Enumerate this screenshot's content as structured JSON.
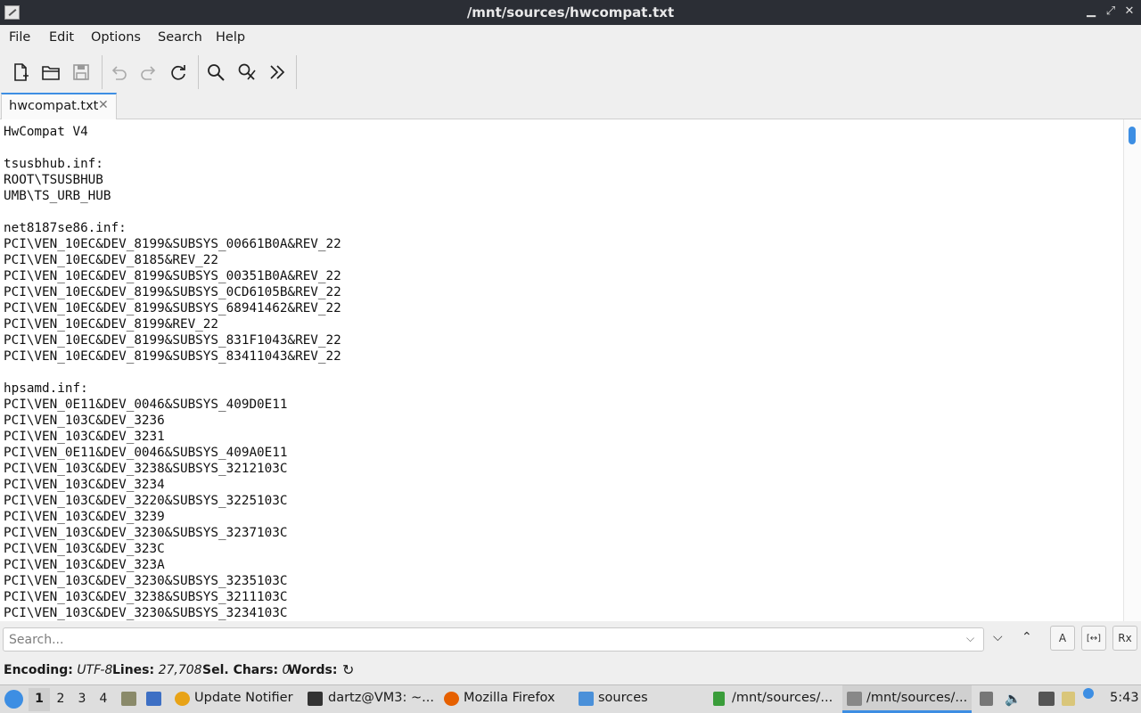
{
  "window": {
    "title": "/mnt/sources/hwcompat.txt",
    "minimize": "▁",
    "maximize": "⤢",
    "close": "✕"
  },
  "menu": {
    "file": "File",
    "edit": "Edit",
    "options": "Options",
    "search": "Search",
    "help": "Help"
  },
  "toolbar_icons": [
    "new-document-icon",
    "open-folder-icon",
    "save-icon",
    "undo-icon",
    "redo-icon",
    "reload-icon",
    "find-icon",
    "replace-icon",
    "more-icon"
  ],
  "tab": {
    "label": "hwcompat.txt",
    "close": "✕"
  },
  "editor": {
    "lines": [
      "HwCompat V4",
      "",
      "tsusbhub.inf:",
      "ROOT\\TSUSBHUB",
      "UMB\\TS_URB_HUB",
      "",
      "net8187se86.inf:",
      "PCI\\VEN_10EC&DEV_8199&SUBSYS_00661B0A&REV_22",
      "PCI\\VEN_10EC&DEV_8185&REV_22",
      "PCI\\VEN_10EC&DEV_8199&SUBSYS_00351B0A&REV_22",
      "PCI\\VEN_10EC&DEV_8199&SUBSYS_0CD6105B&REV_22",
      "PCI\\VEN_10EC&DEV_8199&SUBSYS_68941462&REV_22",
      "PCI\\VEN_10EC&DEV_8199&REV_22",
      "PCI\\VEN_10EC&DEV_8199&SUBSYS_831F1043&REV_22",
      "PCI\\VEN_10EC&DEV_8199&SUBSYS_83411043&REV_22",
      "",
      "hpsamd.inf:",
      "PCI\\VEN_0E11&DEV_0046&SUBSYS_409D0E11",
      "PCI\\VEN_103C&DEV_3236",
      "PCI\\VEN_103C&DEV_3231",
      "PCI\\VEN_0E11&DEV_0046&SUBSYS_409A0E11",
      "PCI\\VEN_103C&DEV_3238&SUBSYS_3212103C",
      "PCI\\VEN_103C&DEV_3234",
      "PCI\\VEN_103C&DEV_3220&SUBSYS_3225103C",
      "PCI\\VEN_103C&DEV_3239",
      "PCI\\VEN_103C&DEV_3230&SUBSYS_3237103C",
      "PCI\\VEN_103C&DEV_323C",
      "PCI\\VEN_103C&DEV_323A",
      "PCI\\VEN_103C&DEV_3230&SUBSYS_3235103C",
      "PCI\\VEN_103C&DEV_3238&SUBSYS_3211103C",
      "PCI\\VEN_103C&DEV_3230&SUBSYS_3234103C"
    ]
  },
  "search": {
    "placeholder": "Search...",
    "dropdown": "⌵",
    "next": "⌵",
    "prev": "⌃",
    "case_label": "A",
    "whole_word_label": "[↔]",
    "regex_label": "Rx"
  },
  "status": {
    "encoding_label": "Encoding:",
    "encoding_value": "UTF-8",
    "lines_label": "Lines:",
    "lines_value": "27,708",
    "sel_label": "Sel. Chars:",
    "sel_value": "0",
    "words_label": "Words:",
    "refresh": "↻"
  },
  "taskbar": {
    "workspaces": [
      "1",
      "2",
      "3",
      "4"
    ],
    "apps": [
      {
        "label": "Update Notifier",
        "icon": "update-notifier-icon",
        "color": "#e8a317"
      },
      {
        "label": "dartz@VM3: ~...",
        "icon": "terminal-icon",
        "color": "#333333"
      },
      {
        "label": "Mozilla Firefox",
        "icon": "firefox-icon",
        "color": "#e66000"
      },
      {
        "label": "sources",
        "icon": "folder-icon",
        "color": "#4a90d9"
      },
      {
        "label": "/mnt/sources/...",
        "icon": "document-icon",
        "color": "#3a9d3a"
      },
      {
        "label": "/mnt/sources/...",
        "icon": "text-editor-icon",
        "color": "#888888"
      }
    ],
    "clock": "5:43"
  },
  "colors": {
    "accent": "#3d8ee3",
    "titlebar": "#2b2e35"
  }
}
